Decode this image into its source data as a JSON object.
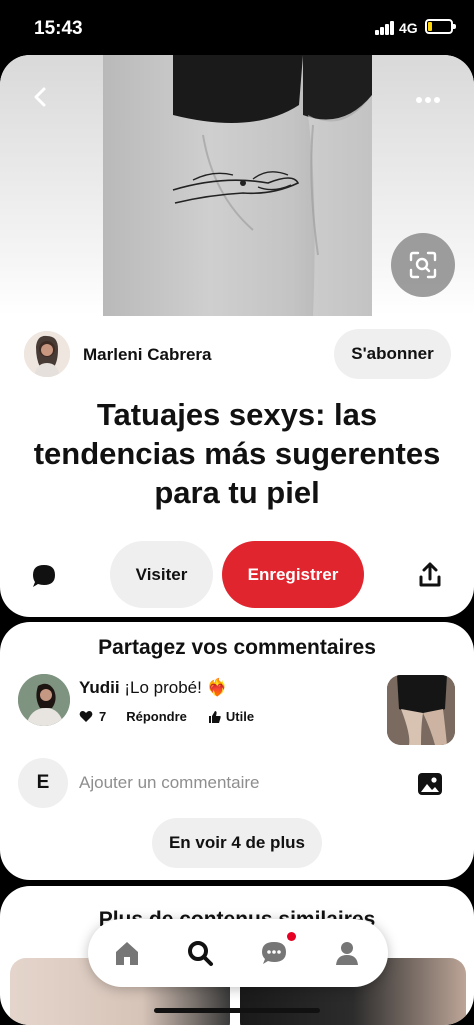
{
  "status_bar": {
    "time": "15:43",
    "network": "4G"
  },
  "pin": {
    "creator_name": "Marleni Cabrera",
    "follow_label": "S'abonner",
    "title": "Tatuajes sexys: las tendencias más sugerentes para tu piel",
    "visit_label": "Visiter",
    "save_label": "Enregistrer"
  },
  "comments": {
    "title": "Partagez vos commentaires",
    "items": [
      {
        "author": "Yudii",
        "text": "¡Lo probé! ❤️‍🔥",
        "likes": "7",
        "reply_label": "Répondre",
        "helpful_label": "Utile"
      }
    ],
    "me_initial": "E",
    "add_placeholder": "Ajouter un commentaire",
    "more_label": "En voir 4 de plus"
  },
  "similar": {
    "title": "Plus de contenus similaires"
  },
  "nav": {
    "items": [
      "home-icon",
      "search-icon",
      "messages-icon",
      "profile-icon"
    ]
  },
  "colors": {
    "accent": "#e1252e",
    "notification": "#e60023"
  }
}
